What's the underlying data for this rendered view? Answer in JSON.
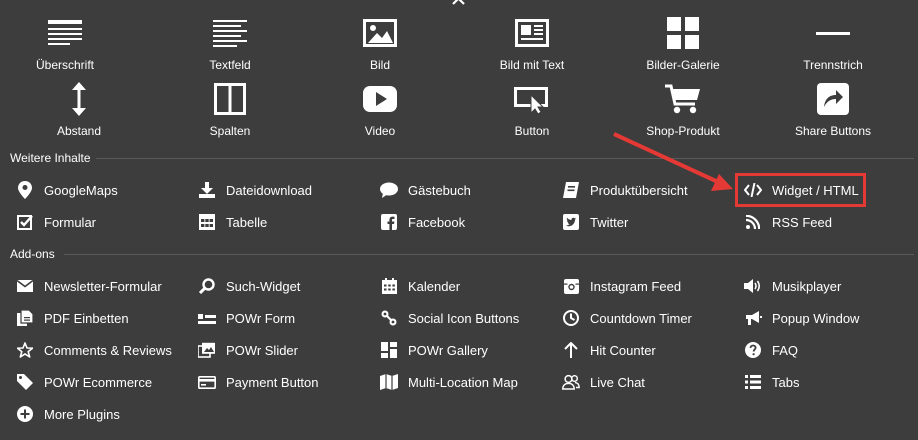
{
  "top_grid": [
    {
      "label": "Überschrift",
      "icon": "heading-icon"
    },
    {
      "label": "Textfeld",
      "icon": "text-field-icon"
    },
    {
      "label": "Bild",
      "icon": "image-icon"
    },
    {
      "label": "Bild mit Text",
      "icon": "image-with-text-icon"
    },
    {
      "label": "Bilder-Galerie",
      "icon": "gallery-grid-icon"
    },
    {
      "label": "Trennstrich",
      "icon": "divider-line-icon"
    },
    {
      "label": "Abstand",
      "icon": "spacing-arrows-icon"
    },
    {
      "label": "Spalten",
      "icon": "columns-icon"
    },
    {
      "label": "Video",
      "icon": "video-play-icon"
    },
    {
      "label": "Button",
      "icon": "button-cursor-icon"
    },
    {
      "label": "Shop-Produkt",
      "icon": "shopping-cart-icon"
    },
    {
      "label": "Share Buttons",
      "icon": "share-arrow-icon"
    }
  ],
  "sections": {
    "weitere": {
      "title": "Weitere Inhalte",
      "items": [
        {
          "label": "GoogleMaps",
          "icon": "map-pin-icon"
        },
        {
          "label": "Dateidownload",
          "icon": "download-icon"
        },
        {
          "label": "Gästebuch",
          "icon": "speech-bubble-icon"
        },
        {
          "label": "Produktübersicht",
          "icon": "book-icon"
        },
        {
          "label": "Widget / HTML",
          "icon": "code-icon"
        },
        {
          "label": "Formular",
          "icon": "checkbox-icon"
        },
        {
          "label": "Tabelle",
          "icon": "table-icon"
        },
        {
          "label": "Facebook",
          "icon": "facebook-icon"
        },
        {
          "label": "Twitter",
          "icon": "twitter-icon"
        },
        {
          "label": "RSS Feed",
          "icon": "rss-icon"
        }
      ]
    },
    "addons": {
      "title": "Add-ons",
      "items": [
        {
          "label": "Newsletter-Formular",
          "icon": "envelope-icon"
        },
        {
          "label": "Such-Widget",
          "icon": "search-icon"
        },
        {
          "label": "Kalender",
          "icon": "calendar-icon"
        },
        {
          "label": "Instagram Feed",
          "icon": "instagram-icon"
        },
        {
          "label": "Musikplayer",
          "icon": "speaker-icon"
        },
        {
          "label": "PDF Einbetten",
          "icon": "pdf-file-icon"
        },
        {
          "label": "POWr Form",
          "icon": "form-lines-icon"
        },
        {
          "label": "Social Icon Buttons",
          "icon": "share-nodes-icon"
        },
        {
          "label": "Countdown Timer",
          "icon": "clock-icon"
        },
        {
          "label": "Popup Window",
          "icon": "megaphone-icon"
        },
        {
          "label": "Comments & Reviews",
          "icon": "star-icon"
        },
        {
          "label": "POWr Slider",
          "icon": "slides-icon"
        },
        {
          "label": "POWr Gallery",
          "icon": "gallery-tiles-icon"
        },
        {
          "label": "Hit Counter",
          "icon": "arrow-up-icon"
        },
        {
          "label": "FAQ",
          "icon": "question-circle-icon"
        },
        {
          "label": "POWr Ecommerce",
          "icon": "tag-icon"
        },
        {
          "label": "Payment Button",
          "icon": "credit-card-icon"
        },
        {
          "label": "Multi-Location Map",
          "icon": "folded-map-icon"
        },
        {
          "label": "Live Chat",
          "icon": "users-icon"
        },
        {
          "label": "Tabs",
          "icon": "list-icon"
        },
        {
          "label": "More Plugins",
          "icon": "plus-circle-icon"
        }
      ]
    }
  },
  "colors": {
    "background": "#3d3d3d",
    "text": "#ffffff",
    "highlight": "#e53935"
  }
}
